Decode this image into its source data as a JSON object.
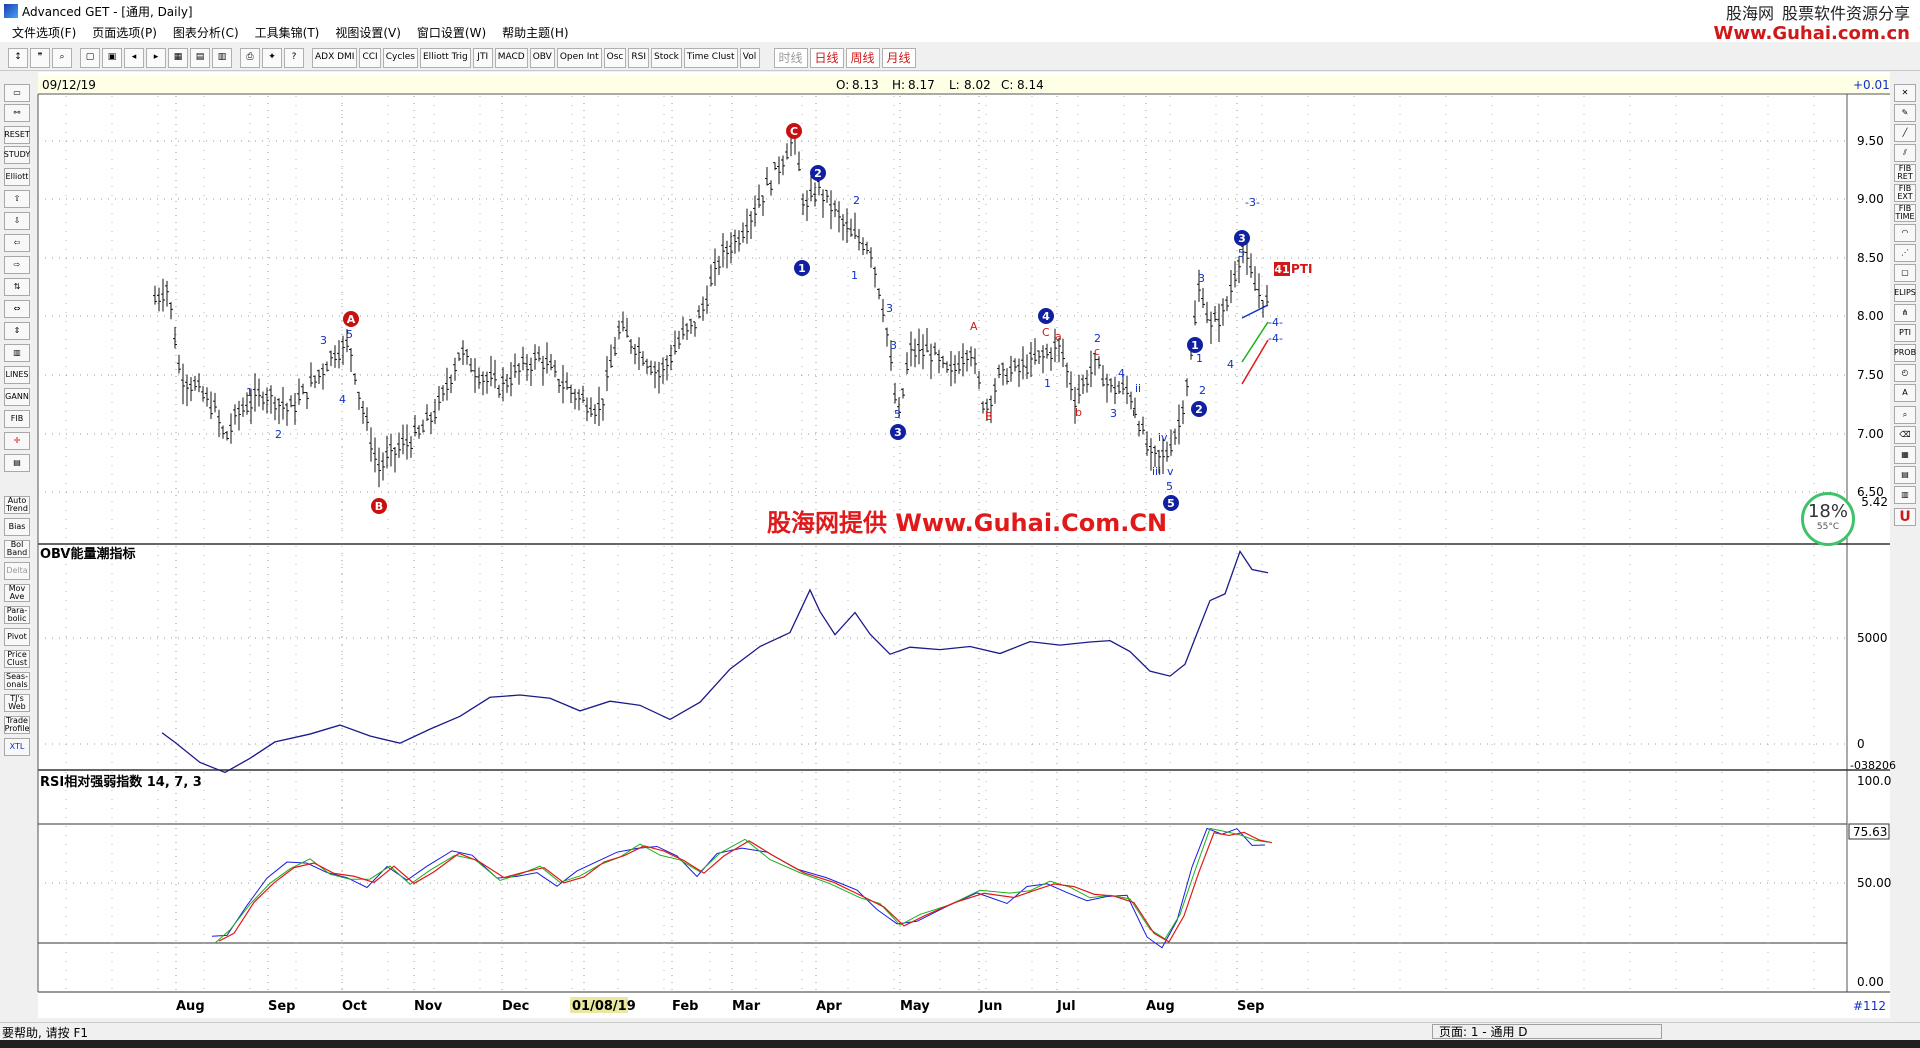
{
  "window": {
    "title": "Advanced GET - [通用, Daily]"
  },
  "menu": [
    "文件选项(F)",
    "页面选项(P)",
    "图表分析(C)",
    "工具集锦(T)",
    "视图设置(V)",
    "窗口设置(W)",
    "帮助主题(H)"
  ],
  "brand": {
    "site": "股海网",
    "tagline": "股票软件资源分享",
    "url": "Www.Guhai.com.cn"
  },
  "toolbar": {
    "indicator_buttons": [
      "ADX DMI",
      "CCI",
      "Cycles",
      "Elliott Trig",
      "JTI",
      "MACD",
      "OBV",
      "Open Int",
      "Osc",
      "RSI",
      "Stock",
      "Time Clust",
      "Vol"
    ],
    "timeframes": [
      {
        "label": "时线",
        "state": "disabled"
      },
      {
        "label": "日线",
        "state": "active"
      },
      {
        "label": "周线",
        "state": "active"
      },
      {
        "label": "月线",
        "state": "active"
      }
    ]
  },
  "left_tools": [
    "RESET",
    "STUDY",
    "Elliott",
    "LINES",
    "GANN",
    "FIB",
    "Auto Trend",
    "Bias",
    "Bol Band",
    "Delta",
    "Mov Ave",
    "Para- bolic",
    "Pivot",
    "Price Clust",
    "Seas- onals",
    "TJ's Web",
    "Trade Profile",
    "XTL"
  ],
  "right_tools": [
    "FIB RET",
    "FIB EXT",
    "FIB TIME",
    "ELIPS",
    "PTI",
    "PROB"
  ],
  "price_panel": {
    "date": "09/12/19",
    "ohlc": {
      "o_label": "O:",
      "o": "8.13",
      "h_label": "H:",
      "h": "8.17",
      "l_label": "L:",
      "l": "8.02",
      "c_label": "C:",
      "c": "8.14"
    },
    "change": "+0.01",
    "y_labels": [
      "9.50",
      "9.00",
      "8.50",
      "8.00",
      "7.50",
      "7.00",
      "6.50"
    ],
    "last_price": "5.42",
    "pti_value": "41",
    "pti_label": "PTI",
    "watermark": "股海网提供 Www.Guhai.Com.CN",
    "wave_labels": {
      "c_top": "C",
      "A": "A",
      "B": "B",
      "w1": "1",
      "w2": "2",
      "w3": "3",
      "w4": "4",
      "w5": "5",
      "w3_proj": "-3-",
      "w4_proj": "-4-",
      "sub1": "1",
      "sub2": "2",
      "sub3": "3",
      "sub4": "4",
      "sub5": "5",
      "la": "a",
      "lb": "b",
      "lc": "c",
      "li": "i",
      "lii": "ii",
      "liii": "iii",
      "liv": "iv",
      "lv": "v"
    }
  },
  "obv_panel": {
    "title": "OBV能量潮指标",
    "y_labels": [
      "5000",
      "0"
    ],
    "bottom_label": "-038206"
  },
  "rsi_panel": {
    "title": "RSI相对强弱指数 14, 7, 3",
    "y_labels": [
      "100.0",
      "75.63",
      "50.00",
      "0.00"
    ]
  },
  "x_axis": {
    "months": [
      "Aug",
      "Sep",
      "Oct",
      "Nov",
      "Dec",
      "01/08/19",
      "Feb",
      "Mar",
      "Apr",
      "May",
      "Jun",
      "Jul",
      "Aug",
      "Sep"
    ],
    "record": "#112"
  },
  "status": {
    "help": "要帮助, 请按 F1",
    "page": "页面: 1 - 通用 D"
  },
  "system": {
    "cpu": "18%",
    "temp": "55°C"
  },
  "colors": {
    "up": "#d01818",
    "blue": "#1030c8",
    "wave_circle_blue": "#1020a0",
    "wave_circle_red": "#c81010",
    "obv_line": "#1a1a8a",
    "rsi_blue": "#1a1ae0",
    "rsi_green": "#1ab01a",
    "rsi_red": "#e01a1a"
  }
}
